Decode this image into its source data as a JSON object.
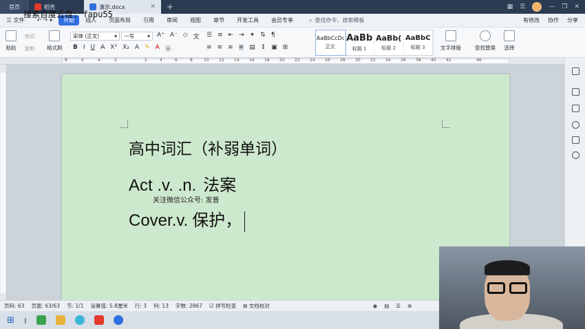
{
  "window": {
    "tabs": [
      {
        "label": "首页"
      },
      {
        "label": "稻壳"
      },
      {
        "label": "演示.docx"
      }
    ],
    "new_tab": "+"
  },
  "overlay": {
    "top_watermark": "搜索百度云盘: fapu55",
    "doc_watermark": "关注微信公众号: 发普"
  },
  "menu": {
    "file": "三 文件",
    "items": [
      "开始",
      "插入",
      "页面布局",
      "引用",
      "审阅",
      "视图",
      "章节",
      "开发工具",
      "会员专享"
    ],
    "active": "开始",
    "search_placeholder": "查找命令、搜索模板",
    "right": [
      "有修改",
      "协作",
      "分享"
    ]
  },
  "ribbon": {
    "paste": "粘贴",
    "cut": "剪切",
    "copy": "复制",
    "format_painter": "格式刷",
    "font_name": "宋体 (正文)",
    "font_size": "一号",
    "bold": "B",
    "italic": "I",
    "underline": "U",
    "styles": [
      {
        "preview": "AaBbCcDd",
        "label": "正文"
      },
      {
        "preview": "AaBb",
        "label": "标题 1"
      },
      {
        "preview": "AaBb(",
        "label": "标题 2"
      },
      {
        "preview": "AaBbC",
        "label": "标题 3"
      }
    ],
    "text_layout": "文字排版",
    "find_replace": "查找替换",
    "select": "选择"
  },
  "ruler": {
    "marks": [
      "8",
      "6",
      "4",
      "2",
      "2",
      "4",
      "6",
      "8",
      "10",
      "12",
      "14",
      "16",
      "18",
      "20",
      "22",
      "24",
      "26",
      "28",
      "30",
      "32",
      "34",
      "36",
      "38",
      "40",
      "42",
      "46"
    ]
  },
  "document": {
    "line1": "高中词汇（补弱单词）",
    "line2_en": "Act .v.   .n.",
    "line2_cn": "法案",
    "line3_en": "Cover.v.",
    "line3_cn": "保护，"
  },
  "status": {
    "page_num": "页码: 63",
    "pages": "页面: 63/63",
    "section": "节: 1/1",
    "position": "设置值: 5.8厘米",
    "row": "行: 3",
    "col": "列: 13",
    "words": "字数: 2867",
    "spell": "拼写检查",
    "proof": "文档校对"
  },
  "colors": {
    "page_bg": "#cde9cd",
    "accent": "#2f6fe0",
    "titlebar": "#2b3b52"
  }
}
